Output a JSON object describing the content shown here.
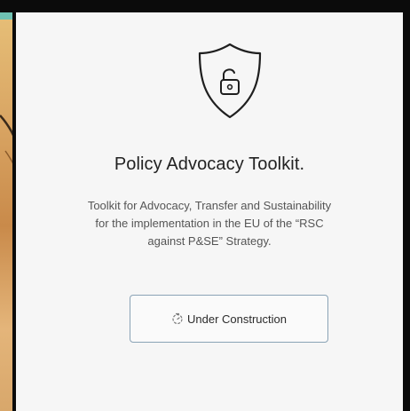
{
  "card": {
    "title": "Policy Advocacy Toolkit.",
    "description_lines": [
      "Toolkit for Advocacy, Transfer and Sustainability",
      "for the implementation in the EU of the “RSC",
      "against P&SE” Strategy."
    ]
  },
  "button": {
    "label": "Under Construction",
    "icon": "timer-icon"
  },
  "icons": {
    "shield": "shield-unlock-icon"
  },
  "colors": {
    "card_background": "#f6f6f6",
    "title_text": "#222222",
    "body_text": "#555555",
    "button_border": "#8aa3b6",
    "frame": "#0b0b0b"
  }
}
